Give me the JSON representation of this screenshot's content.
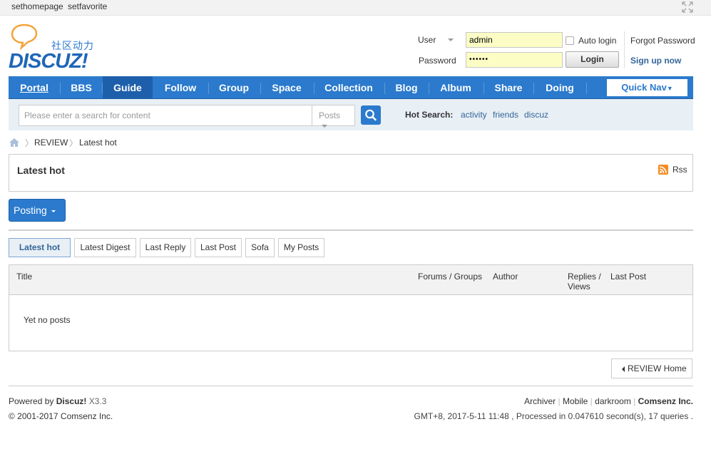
{
  "topbar": {
    "sethomepage": "sethomepage",
    "setfavorite": "setfavorite"
  },
  "logo": {
    "cn": "社区动力",
    "brand": "DISCUZ!"
  },
  "login": {
    "user_label": "User",
    "user_value": "admin",
    "password_label": "Password",
    "password_value": "••••••",
    "auto_login": "Auto login",
    "login_button": "Login",
    "forgot": "Forgot Password",
    "signup": "Sign up now"
  },
  "nav": {
    "items": [
      "Portal",
      "BBS",
      "Guide",
      "Follow",
      "Group",
      "Space",
      "Collection",
      "Blog",
      "Album",
      "Share",
      "Doing"
    ],
    "active": "Guide",
    "quick_nav": "Quick Nav"
  },
  "search": {
    "placeholder": "Please enter a search for content",
    "type": "Posts",
    "hot_label": "Hot Search:",
    "keywords": [
      "activity",
      "friends",
      "discuz"
    ]
  },
  "breadcrumb": [
    "REVIEW",
    "Latest hot"
  ],
  "section": {
    "title": "Latest hot",
    "rss": "Rss"
  },
  "posting_button": "Posting",
  "tabs": [
    "Latest hot",
    "Latest Digest",
    "Last Reply",
    "Last Post",
    "Sofa",
    "My Posts"
  ],
  "table": {
    "headers": {
      "title": "Title",
      "forums": "Forums / Groups",
      "author": "Author",
      "replies": "Replies /",
      "views": "Views",
      "last_post": "Last Post"
    },
    "empty": "Yet no posts"
  },
  "home_button": "REVIEW Home",
  "footer": {
    "powered_prefix": "Powered by",
    "powered_brand": "Discuz!",
    "version": "X3.3",
    "copyright": "© 2001-2017 Comsenz Inc.",
    "links": [
      "Archiver",
      "Mobile",
      "darkroom"
    ],
    "company": "Comsenz Inc.",
    "stats": "GMT+8, 2017-5-11 11:48 , Processed in 0.047610 second(s), 17 queries ."
  },
  "colors": {
    "nav": "#2b7acd",
    "nav_active": "#1d5fab",
    "link": "#336699",
    "input_bg": "#fcfdc5"
  }
}
